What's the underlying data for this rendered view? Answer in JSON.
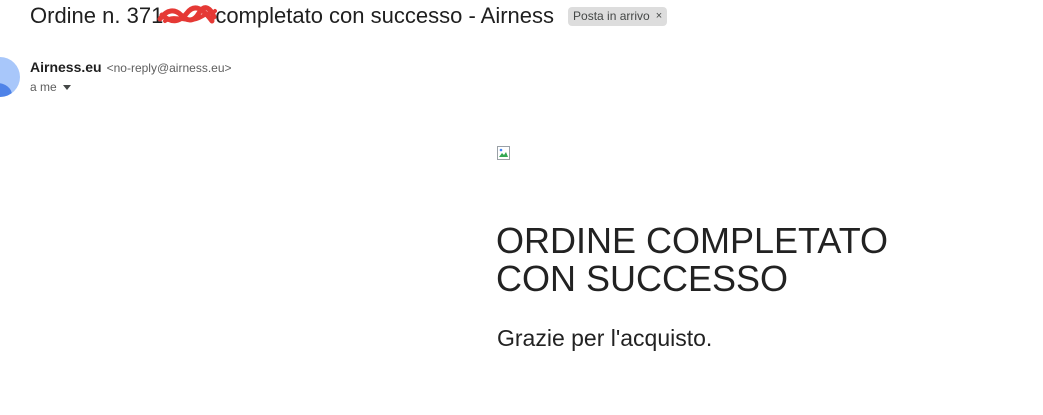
{
  "email": {
    "subject_prefix": "Ordine n. 371",
    "subject_suffix": "completato con successo - Airness",
    "label_chip": "Posta in arrivo",
    "label_chip_close": "×",
    "sender_name": "Airness.eu",
    "sender_email": "<no-reply@airness.eu>",
    "recipient_line": "a me",
    "redaction_color": "#e53935"
  },
  "body": {
    "image_icon": "broken-image-icon",
    "headline_line1": "ORDINE COMPLETATO",
    "headline_line2": "CON SUCCESSO",
    "thanks": "Grazie per l'acquisto."
  },
  "colors": {
    "avatar_bg": "#a8c7fa",
    "avatar_fg": "#4f83e8",
    "chip_bg": "#dddddd"
  }
}
